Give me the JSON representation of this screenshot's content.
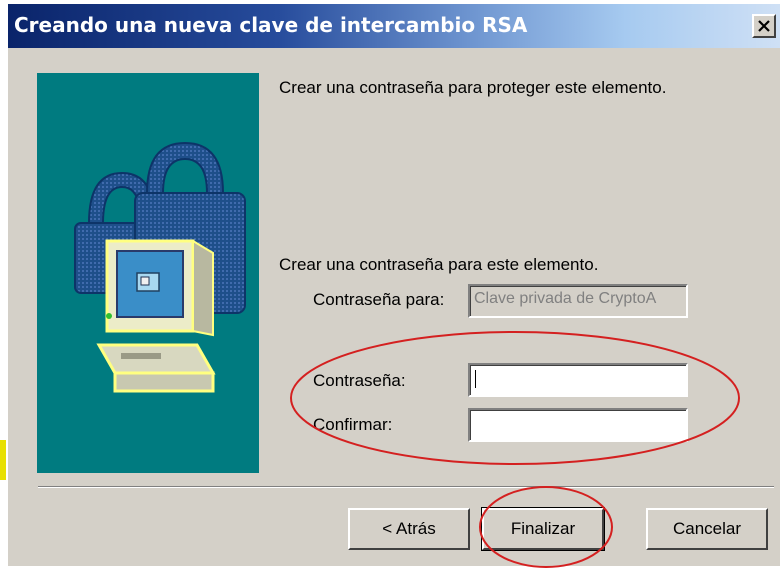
{
  "window": {
    "title": "Creando una nueva clave de intercambio RSA",
    "close_label": "x"
  },
  "content": {
    "header_text": "Crear una contraseña para proteger este elemento.",
    "section_text": "Crear una contraseña para este elemento.",
    "password_for_label": "Contraseña para:",
    "password_for_value": "Clave privada de CryptoA",
    "password_label": "Contraseña:",
    "password_value": "",
    "confirm_label": "Confirmar:",
    "confirm_value": ""
  },
  "buttons": {
    "back": "< Atrás",
    "finish": "Finalizar",
    "cancel": "Cancelar"
  },
  "icons": {
    "illustration": "lock-computer-icon",
    "close": "close-icon"
  },
  "colors": {
    "title_start": "#0a246a",
    "side_panel": "#007b80",
    "annotation": "#d42020",
    "dialog_bg": "#d4d0c8"
  }
}
